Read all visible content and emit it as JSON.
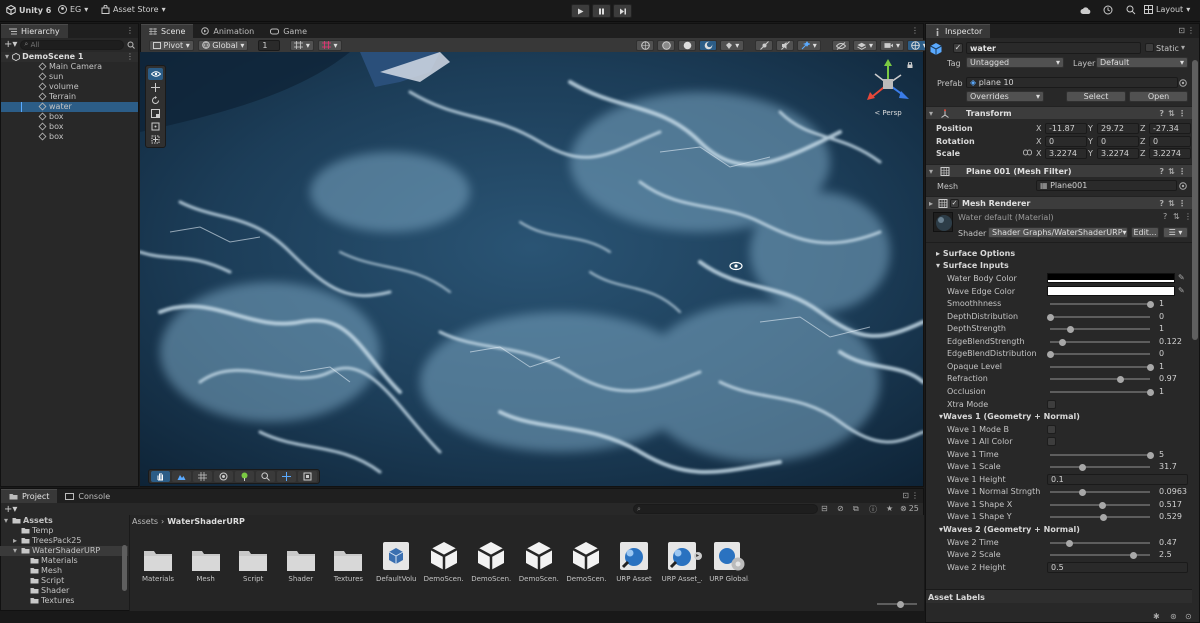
{
  "toolbar": {
    "app_name": "Unity 6",
    "account": "EG",
    "asset_store": "Asset Store",
    "layout": "Layout"
  },
  "hierarchy": {
    "tab": "Hierarchy",
    "search_placeholder": "All",
    "scene": "DemoScene 1",
    "items": [
      {
        "label": "Main Camera"
      },
      {
        "label": "sun"
      },
      {
        "label": "volume"
      },
      {
        "label": "Terrain"
      },
      {
        "label": "water",
        "selected": true
      },
      {
        "label": "box"
      },
      {
        "label": "box"
      },
      {
        "label": "box"
      }
    ]
  },
  "scene_view": {
    "tabs": [
      "Scene",
      "Animation",
      "Game"
    ],
    "pivot": "Pivot",
    "space": "Global",
    "snap": "1",
    "gizmo_label": "Persp"
  },
  "inspector": {
    "tab": "Inspector",
    "object_name": "water",
    "static_label": "Static",
    "tag_label": "Tag",
    "tag_value": "Untagged",
    "layer_label": "Layer",
    "layer_value": "Default",
    "prefab_label": "Prefab",
    "prefab_value": "plane 10",
    "overrides": "Overrides",
    "select_btn": "Select",
    "open_btn": "Open",
    "transform": {
      "title": "Transform",
      "position_label": "Position",
      "rotation_label": "Rotation",
      "scale_label": "Scale",
      "position": {
        "x": "-11.87",
        "y": "29.72",
        "z": "-27.34"
      },
      "rotation": {
        "x": "0",
        "y": "0",
        "z": "0"
      },
      "scale": {
        "x": "3.2274",
        "y": "3.2274",
        "z": "3.2274"
      }
    },
    "mesh_filter": {
      "title": "Plane 001 (Mesh Filter)",
      "mesh_label": "Mesh",
      "mesh_value": "Plane001"
    },
    "mesh_renderer": {
      "title": "Mesh Renderer",
      "material": "Water default (Material)",
      "shader_label": "Shader",
      "shader_value": "Shader Graphs/WaterShaderURP",
      "edit_btn": "Edit..."
    },
    "sections": {
      "surface_options": "Surface Options",
      "surface_inputs": "Surface Inputs",
      "waves1": "Waves 1 (Geometry + Normal)",
      "waves2": "Waves 2 (Geometry + Normal)",
      "asset_labels": "Asset Labels"
    },
    "props": [
      {
        "label": "Water Body Color",
        "kind": "color",
        "color": "#000000"
      },
      {
        "label": "Wave Edge Color",
        "kind": "color",
        "color": "#ffffff"
      },
      {
        "label": "Smoothhness",
        "kind": "slider",
        "pos": 1.0,
        "value": "1"
      },
      {
        "label": "DepthDistribution",
        "kind": "slider",
        "pos": 0.0,
        "value": "0"
      },
      {
        "label": "DepthStrength",
        "kind": "slider",
        "pos": 0.2,
        "value": "1"
      },
      {
        "label": "EdgeBlendStrength",
        "kind": "slider",
        "pos": 0.122,
        "value": "0.122"
      },
      {
        "label": "EdgeBlendDistribution",
        "kind": "slider",
        "pos": 0.0,
        "value": "0"
      },
      {
        "label": "Opaque Level",
        "kind": "slider",
        "pos": 1.0,
        "value": "1"
      },
      {
        "label": "Refraction",
        "kind": "slider",
        "pos": 0.7,
        "value": "0.97"
      },
      {
        "label": "Occlusion",
        "kind": "slider",
        "pos": 1.0,
        "value": "1"
      },
      {
        "label": "Xtra Mode",
        "kind": "toggle"
      },
      {
        "label": "Waves 1 (Geometry + Normal)",
        "kind": "section"
      },
      {
        "label": "Wave 1 Mode B",
        "kind": "toggle"
      },
      {
        "label": "Wave 1 All Color",
        "kind": "toggle"
      },
      {
        "label": "Wave 1 Time",
        "kind": "slider",
        "pos": 1.0,
        "value": "5"
      },
      {
        "label": "Wave 1 Scale",
        "kind": "slider",
        "pos": 0.32,
        "value": "31.7"
      },
      {
        "label": "Wave 1 Height",
        "kind": "float",
        "value": "0.1"
      },
      {
        "label": "Wave 1 Normal Strngth",
        "kind": "slider",
        "pos": 0.32,
        "value": "0.0963"
      },
      {
        "label": "Wave 1 Shape X",
        "kind": "slider",
        "pos": 0.52,
        "value": "0.517"
      },
      {
        "label": "Wave 1 Shape Y",
        "kind": "slider",
        "pos": 0.53,
        "value": "0.529"
      },
      {
        "label": "Waves 2 (Geometry + Normal)",
        "kind": "section"
      },
      {
        "label": "Wave 2 Time",
        "kind": "slider",
        "pos": 0.19,
        "value": "0.47"
      },
      {
        "label": "Wave 2 Scale",
        "kind": "slider",
        "pos": 0.83,
        "value": "2.5"
      },
      {
        "label": "Wave 2 Height",
        "kind": "float",
        "value": "0.5"
      }
    ]
  },
  "project": {
    "tabs": [
      "Project",
      "Console"
    ],
    "tree": [
      {
        "label": "Assets",
        "level": 0
      },
      {
        "label": "Temp",
        "level": 1
      },
      {
        "label": "TreesPack25",
        "level": 1
      },
      {
        "label": "WaterShaderURP",
        "level": 1,
        "selected": true
      },
      {
        "label": "Materials",
        "level": 2
      },
      {
        "label": "Mesh",
        "level": 2
      },
      {
        "label": "Script",
        "level": 2
      },
      {
        "label": "Shader",
        "level": 2
      },
      {
        "label": "Textures",
        "level": 2
      }
    ],
    "breadcrumb_root": "Assets",
    "breadcrumb_current": "WaterShaderURP",
    "visible_count": "25",
    "assets": [
      {
        "label": "Materials",
        "icon": "folder"
      },
      {
        "label": "Mesh",
        "icon": "folder"
      },
      {
        "label": "Script",
        "icon": "folder"
      },
      {
        "label": "Shader",
        "icon": "folder"
      },
      {
        "label": "Textures",
        "icon": "folder"
      },
      {
        "label": "DefaultVolu...",
        "icon": "volume"
      },
      {
        "label": "DemoScen...",
        "icon": "unity"
      },
      {
        "label": "DemoScen...",
        "icon": "unity"
      },
      {
        "label": "DemoScen...",
        "icon": "unity"
      },
      {
        "label": "DemoScen...",
        "icon": "unity"
      },
      {
        "label": "URP Asset",
        "icon": "urp"
      },
      {
        "label": "URP Asset_...",
        "icon": "urp"
      },
      {
        "label": "URP Global...",
        "icon": "urp-gear"
      }
    ]
  }
}
